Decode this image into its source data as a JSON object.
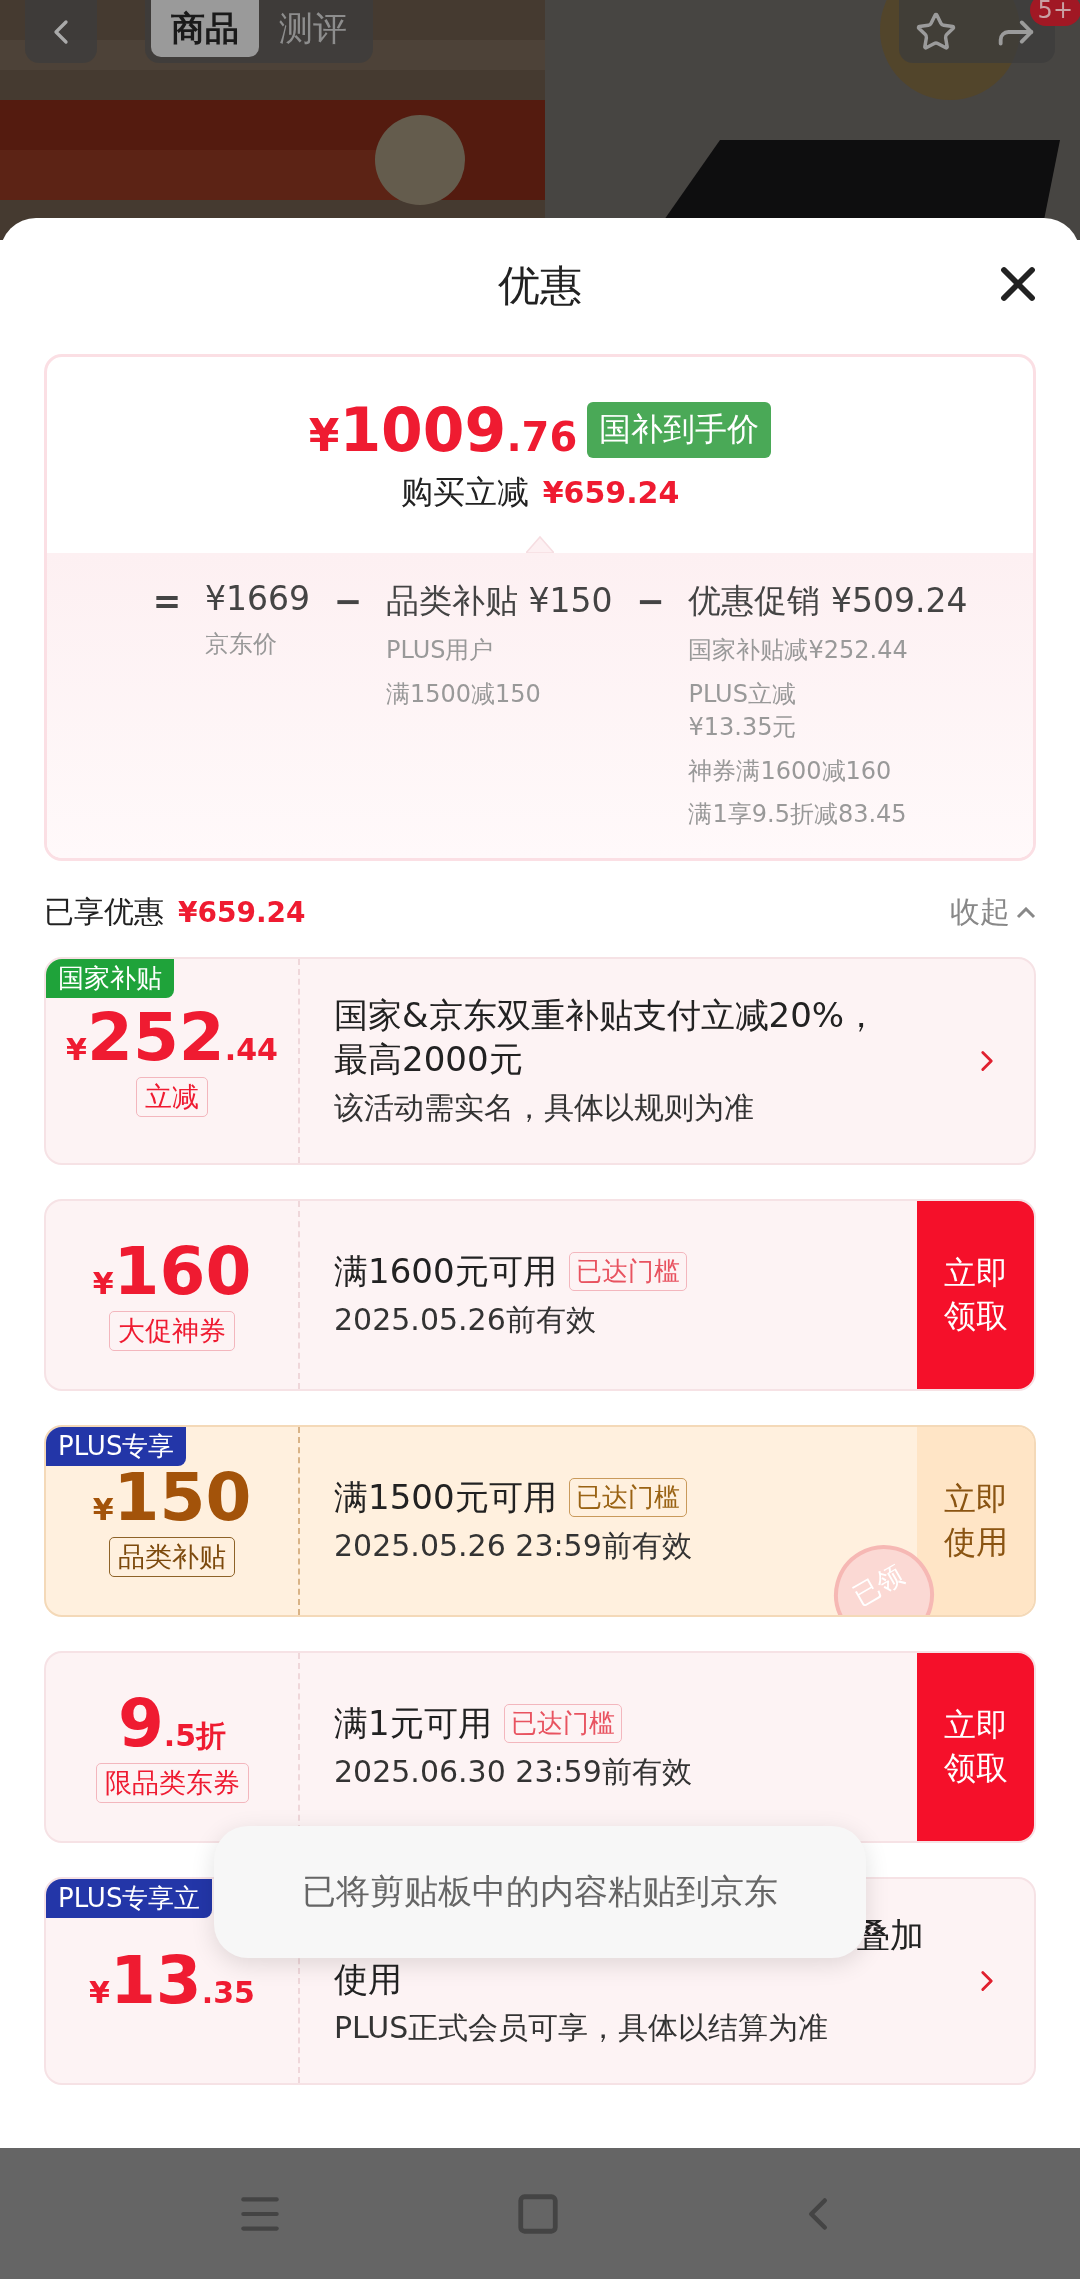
{
  "header": {
    "tabs": [
      {
        "label": "商品",
        "selected": true
      },
      {
        "label": "测评",
        "selected": false
      }
    ],
    "badge": "5+"
  },
  "sheet": {
    "title": "优惠"
  },
  "price_card": {
    "price_symbol": "¥",
    "price_main": "1009",
    "price_decimal": ".76",
    "price_tag": "国补到手价",
    "saving_label": "购买立减",
    "saving_amount": "¥659.24",
    "breakdown": [
      {
        "operator": "=",
        "amount": "¥1669",
        "notes": [
          "京东价"
        ]
      },
      {
        "operator": "−",
        "amount": "品类补贴 ¥150",
        "notes": [
          "PLUS用户",
          "满1500减150"
        ]
      },
      {
        "operator": "−",
        "amount": "优惠促销 ¥509.24",
        "notes": [
          "国家补贴减¥252.44",
          "PLUS立减¥13.35元",
          "神券满1600减160",
          "满1享9.5折减83.45"
        ]
      }
    ]
  },
  "summary": {
    "label": "已享优惠",
    "amount": "¥659.24",
    "toggle": "收起",
    "expanded": true
  },
  "coupons": [
    {
      "kind": "detail",
      "tag": {
        "text": "国家补贴",
        "color": "#1fa33a"
      },
      "symbol": "¥",
      "main": "252",
      "decimal": ".44",
      "caption": "立减",
      "title": "国家&京东双重补贴支付立减20%，最高2000元",
      "subtitle": "该活动需实名，具体以规则为准"
    },
    {
      "kind": "claim",
      "symbol": "¥",
      "main": "160",
      "caption": "大促神券",
      "title": "满1600元可用",
      "threshold": "已达门槛",
      "subtitle": "2025.05.26前有效",
      "action": "立即领取"
    },
    {
      "kind": "use",
      "tag": {
        "text": "PLUS专享",
        "color": "#2336a8"
      },
      "symbol": "¥",
      "main": "150",
      "caption": "品类补贴",
      "title": "满1500元可用",
      "threshold": "已达门槛",
      "subtitle": "2025.05.26 23:59前有效",
      "action": "立即使用",
      "stamp": "已领"
    },
    {
      "kind": "claim",
      "main": "9",
      "decimal": ".5折",
      "caption": "限品类东券",
      "title": "满1元可用",
      "threshold": "已达门槛",
      "subtitle": "2025.06.30 23:59前有效",
      "action": "立即领取"
    },
    {
      "kind": "detail",
      "tag": {
        "text": "PLUS专享立",
        "color": "#2336a8"
      },
      "symbol": "¥",
      "main": "13",
      "decimal": ".35",
      "title_tail": "叠加",
      "title": "使用",
      "subtitle": "PLUS正式会员可享，具体以结算为准"
    }
  ],
  "toast": "已将剪贴板中的内容粘贴到京东"
}
